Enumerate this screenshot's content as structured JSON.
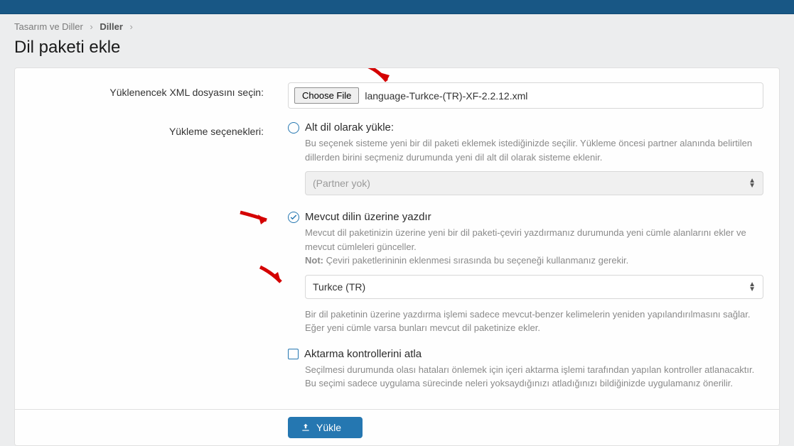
{
  "breadcrumb": {
    "root": "Tasarım ve Diller",
    "current": "Diller"
  },
  "page_title": "Dil paketi ekle",
  "file_row": {
    "label": "Yüklenencek XML dosyasını seçin:",
    "button": "Choose File",
    "filename": "language-Turkce-(TR)-XF-2.2.12.xml"
  },
  "options_label": "Yükleme seçenekleri:",
  "radio_child": {
    "label": "Alt dil olarak yükle:",
    "desc": "Bu seçenek sisteme yeni bir dil paketi eklemek istediğinizde seçilir. Yükleme öncesi partner alanında belirtilen dillerden birini seçmeniz durumunda yeni dil alt dil olarak sisteme eklenir.",
    "select": "(Partner yok)"
  },
  "radio_overwrite": {
    "label": "Mevcut dilin üzerine yazdır",
    "desc1": "Mevcut dil paketinizin üzerine yeni bir dil paketi-çeviri yazdırmanız durumunda yeni cümle alanlarını ekler ve mevcut cümleleri günceller.",
    "note_label": "Not:",
    "note": " Çeviri paketlerininin eklenmesi sırasında bu seçeneği kullanmanız gerekir.",
    "select": "Turkce (TR)",
    "desc2": "Bir dil paketinin üzerine yazdırma işlemi sadece mevcut-benzer kelimelerin yeniden yapılandırılmasını sağlar. Eğer yeni cümle varsa bunları mevcut dil paketinize ekler."
  },
  "checkbox_skip": {
    "label": "Aktarma kontrollerini atla",
    "desc": "Seçilmesi durumunda olası hataları önlemek için içeri aktarma işlemi tarafından yapılan kontroller atlanacaktır. Bu seçimi sadece uygulama sürecinde neleri yoksaydığınızı atladığınızı bildiğinizde uygulamanız önerilir."
  },
  "submit": "Yükle"
}
